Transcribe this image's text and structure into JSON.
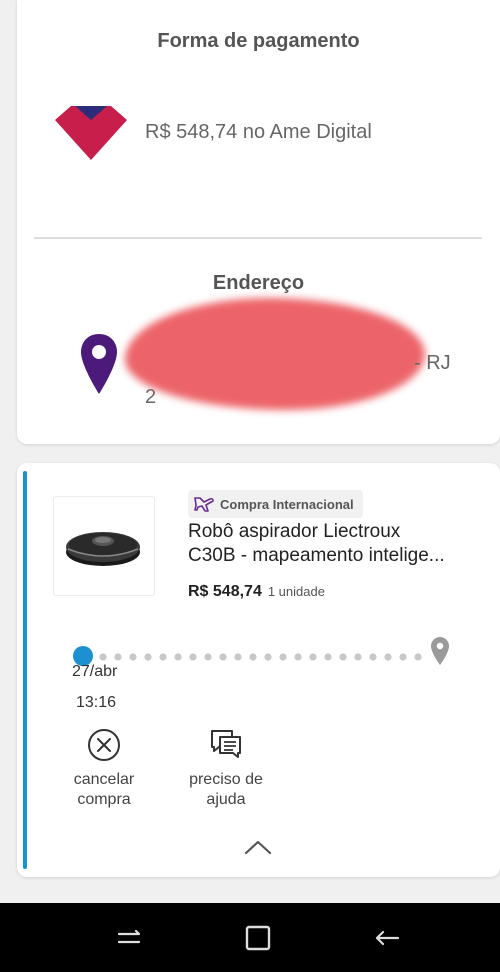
{
  "payment": {
    "title": "Forma de pagamento",
    "amount_text": "R$ 548,74 no Ame Digital",
    "logo_icon": "ame-digital-logo-icon"
  },
  "address": {
    "title": "Endereço",
    "line1_visible": "- RJ",
    "line2_visible": "2",
    "pin_icon": "location-pin-icon"
  },
  "order": {
    "badge_label": "Compra Internacional",
    "badge_icon": "airplane-icon",
    "product_name_line1": "Robô aspirador Liectroux",
    "product_name_line2": "C30B - mapeamento intelige...",
    "price": "R$ 548,74",
    "quantity": "1 unidade",
    "date": "27/abr",
    "time": "13:16",
    "actions": [
      {
        "line1": "cancelar",
        "line2": "compra",
        "icon": "cancel-circle-x-icon"
      },
      {
        "line1": "preciso de",
        "line2": "ajuda",
        "icon": "chat-help-icon"
      }
    ]
  },
  "colors": {
    "accent_blue": "#1e8fd0",
    "pin_purple": "#4b1a7a",
    "ame_red": "#c81e4b",
    "ame_navy": "#2b2d7a",
    "badge_purple": "#6a2b95"
  },
  "navbar": {
    "icons": [
      "recent-apps-icon",
      "home-square-icon",
      "back-arrow-icon"
    ]
  }
}
